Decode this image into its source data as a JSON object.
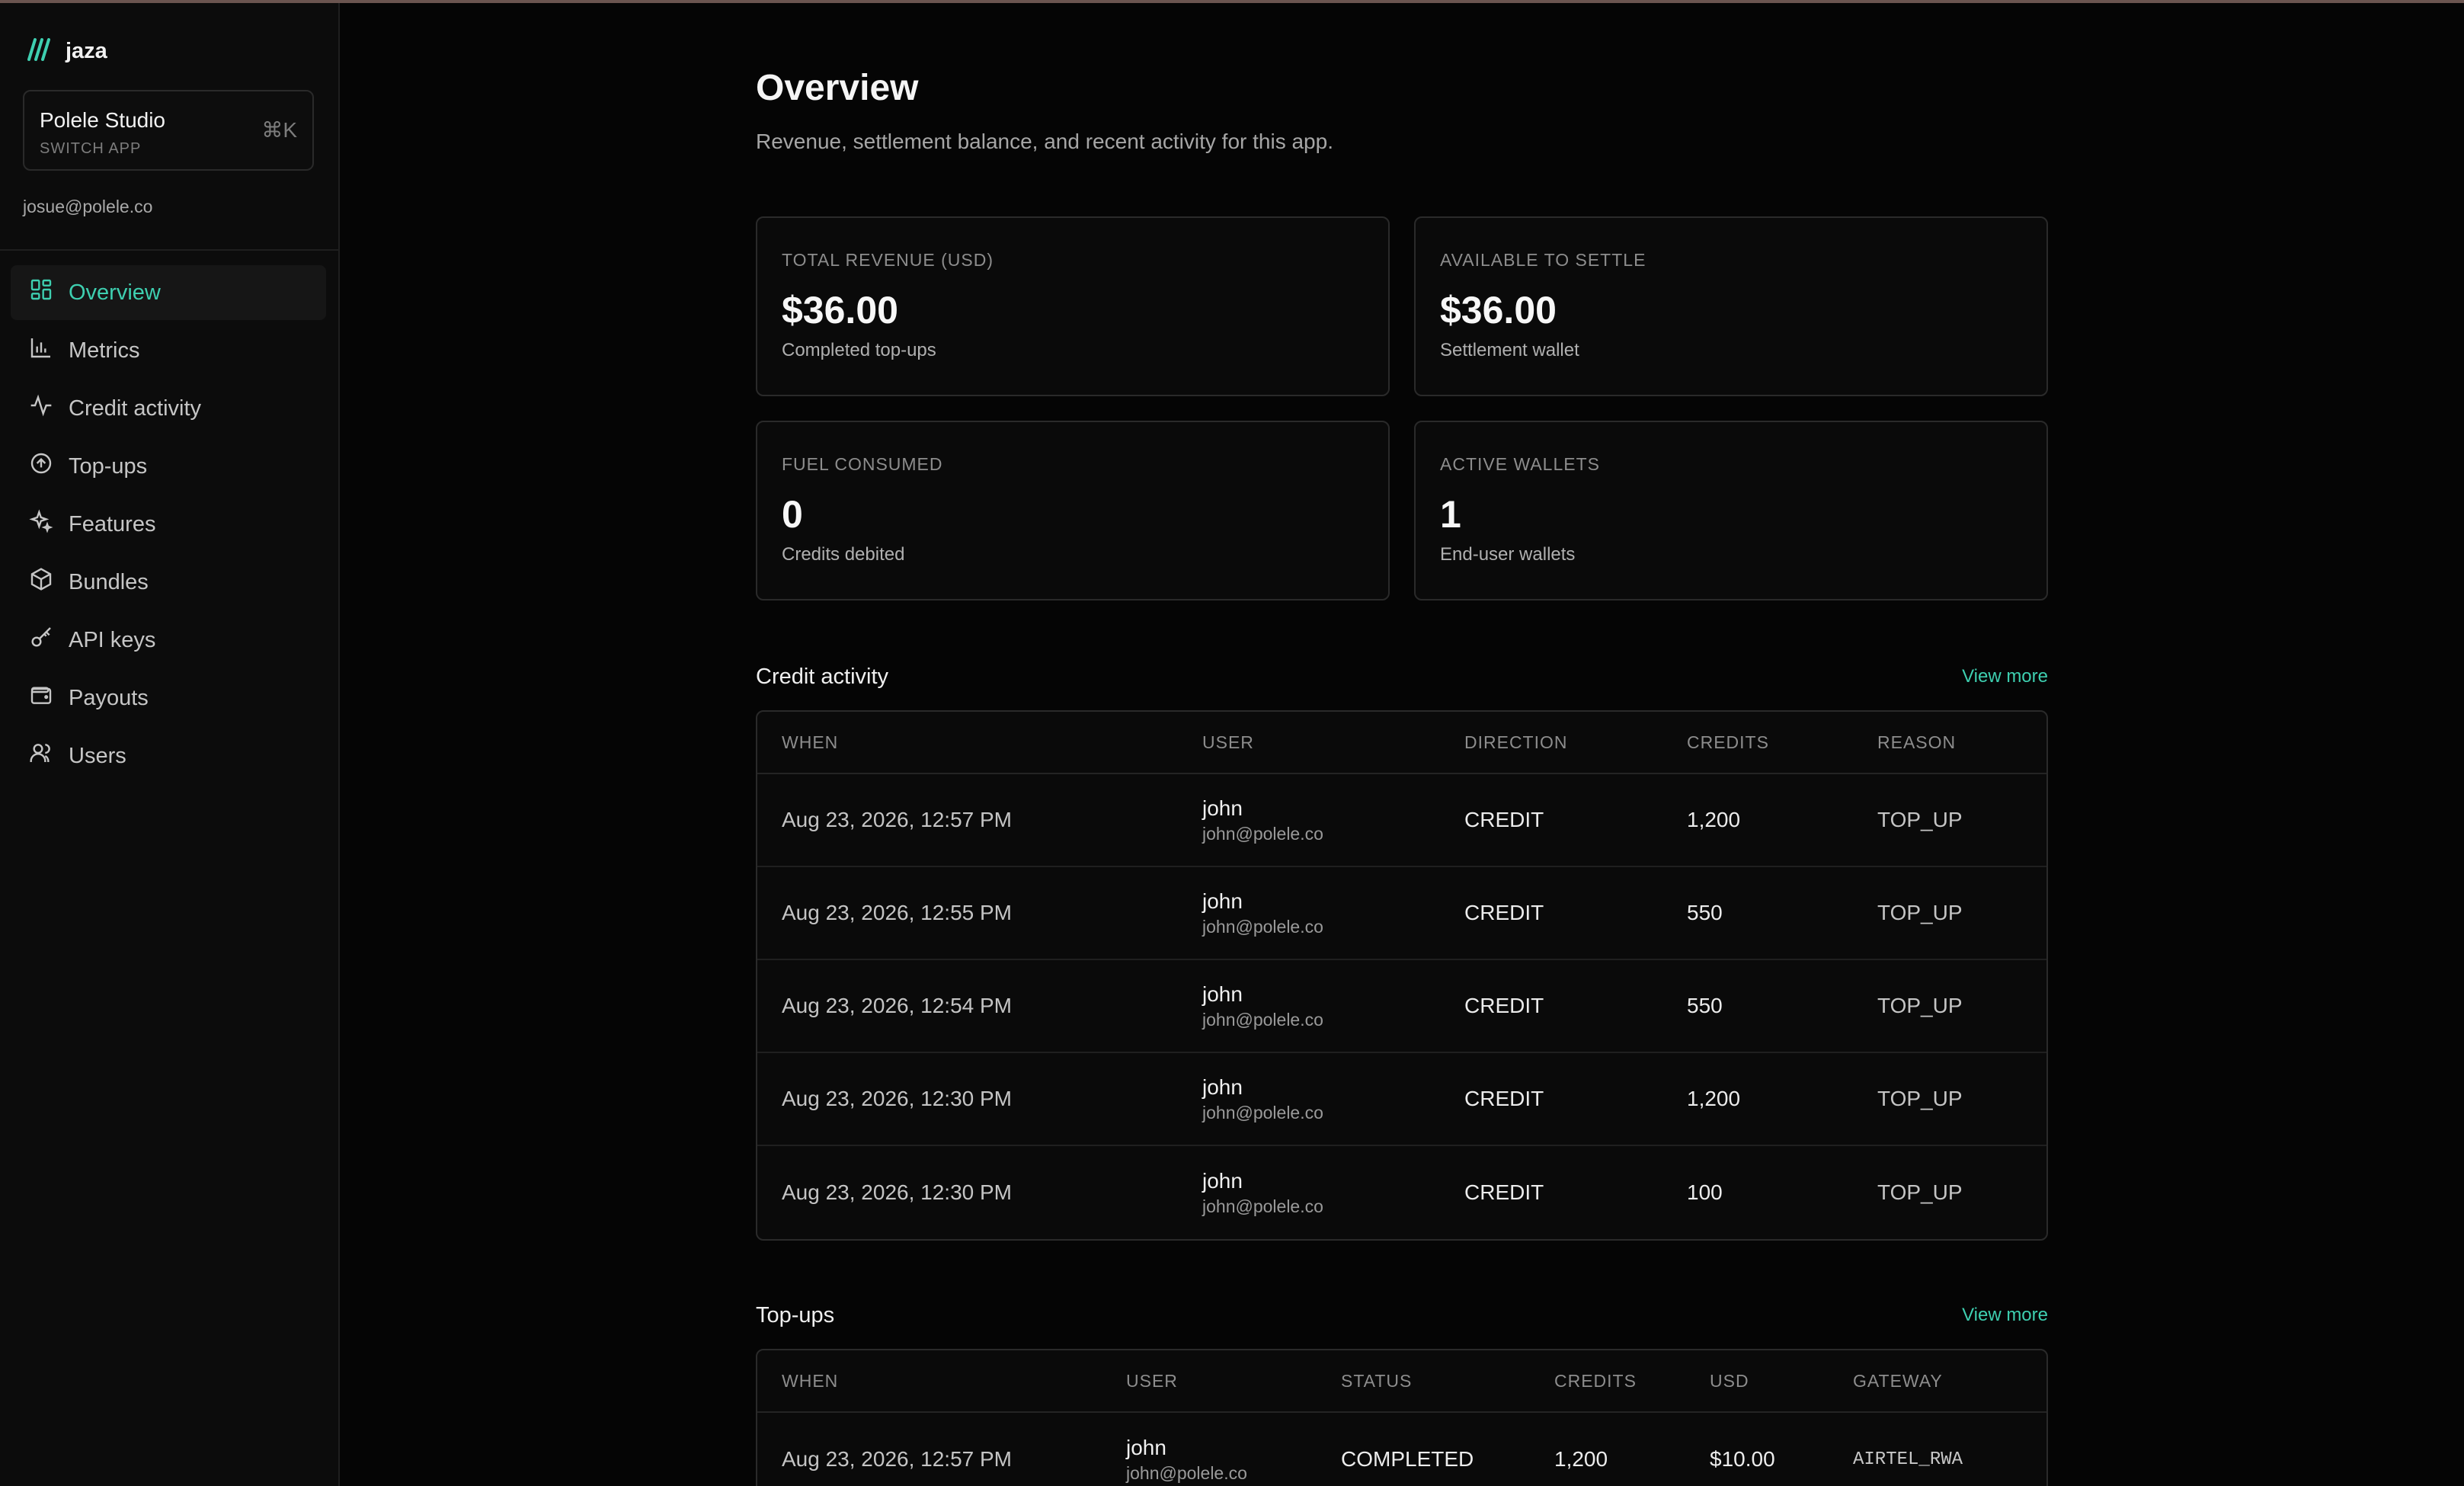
{
  "brand": {
    "name": "jaza"
  },
  "app_switcher": {
    "name": "Polele Studio",
    "sub": "SWITCH APP",
    "shortcut": "⌘K"
  },
  "account": {
    "email": "josue@polele.co"
  },
  "sidebar": {
    "items": [
      {
        "label": "Overview",
        "icon": "grid-icon",
        "active": true
      },
      {
        "label": "Metrics",
        "icon": "bar-chart-icon",
        "active": false
      },
      {
        "label": "Credit activity",
        "icon": "activity-icon",
        "active": false
      },
      {
        "label": "Top-ups",
        "icon": "arrow-up-circle-icon",
        "active": false
      },
      {
        "label": "Features",
        "icon": "sparkles-icon",
        "active": false
      },
      {
        "label": "Bundles",
        "icon": "package-icon",
        "active": false
      },
      {
        "label": "API keys",
        "icon": "key-icon",
        "active": false
      },
      {
        "label": "Payouts",
        "icon": "wallet-icon",
        "active": false
      },
      {
        "label": "Users",
        "icon": "users-icon",
        "active": false
      }
    ]
  },
  "page": {
    "title": "Overview",
    "subtitle": "Revenue, settlement balance, and recent activity for this app."
  },
  "cards": [
    {
      "label": "TOTAL REVENUE (USD)",
      "value": "$36.00",
      "note": "Completed top-ups"
    },
    {
      "label": "AVAILABLE TO SETTLE",
      "value": "$36.00",
      "note": "Settlement wallet"
    },
    {
      "label": "FUEL CONSUMED",
      "value": "0",
      "note": "Credits debited"
    },
    {
      "label": "ACTIVE WALLETS",
      "value": "1",
      "note": "End-user wallets"
    }
  ],
  "credit_activity": {
    "title": "Credit activity",
    "view_more": "View more",
    "columns": [
      "WHEN",
      "USER",
      "DIRECTION",
      "CREDITS",
      "REASON"
    ],
    "rows": [
      {
        "when": "Aug 23, 2026, 12:57 PM",
        "user": "john",
        "email": "john@polele.co",
        "direction": "CREDIT",
        "credits": "1,200",
        "reason": "TOP_UP"
      },
      {
        "when": "Aug 23, 2026, 12:55 PM",
        "user": "john",
        "email": "john@polele.co",
        "direction": "CREDIT",
        "credits": "550",
        "reason": "TOP_UP"
      },
      {
        "when": "Aug 23, 2026, 12:54 PM",
        "user": "john",
        "email": "john@polele.co",
        "direction": "CREDIT",
        "credits": "550",
        "reason": "TOP_UP"
      },
      {
        "when": "Aug 23, 2026, 12:30 PM",
        "user": "john",
        "email": "john@polele.co",
        "direction": "CREDIT",
        "credits": "1,200",
        "reason": "TOP_UP"
      },
      {
        "when": "Aug 23, 2026, 12:30 PM",
        "user": "john",
        "email": "john@polele.co",
        "direction": "CREDIT",
        "credits": "100",
        "reason": "TOP_UP"
      }
    ]
  },
  "topups": {
    "title": "Top-ups",
    "view_more": "View more",
    "columns": [
      "WHEN",
      "USER",
      "STATUS",
      "CREDITS",
      "USD",
      "GATEWAY"
    ],
    "rows": [
      {
        "when": "Aug 23, 2026, 12:57 PM",
        "user": "john",
        "email": "john@polele.co",
        "status": "COMPLETED",
        "credits": "1,200",
        "usd": "$10.00",
        "gateway": "AIRTEL_RWA"
      }
    ]
  },
  "colors": {
    "accent": "#3ecfb0",
    "background": "#050505",
    "sidebar": "#0c0c0c",
    "border": "#2a2a2a"
  }
}
